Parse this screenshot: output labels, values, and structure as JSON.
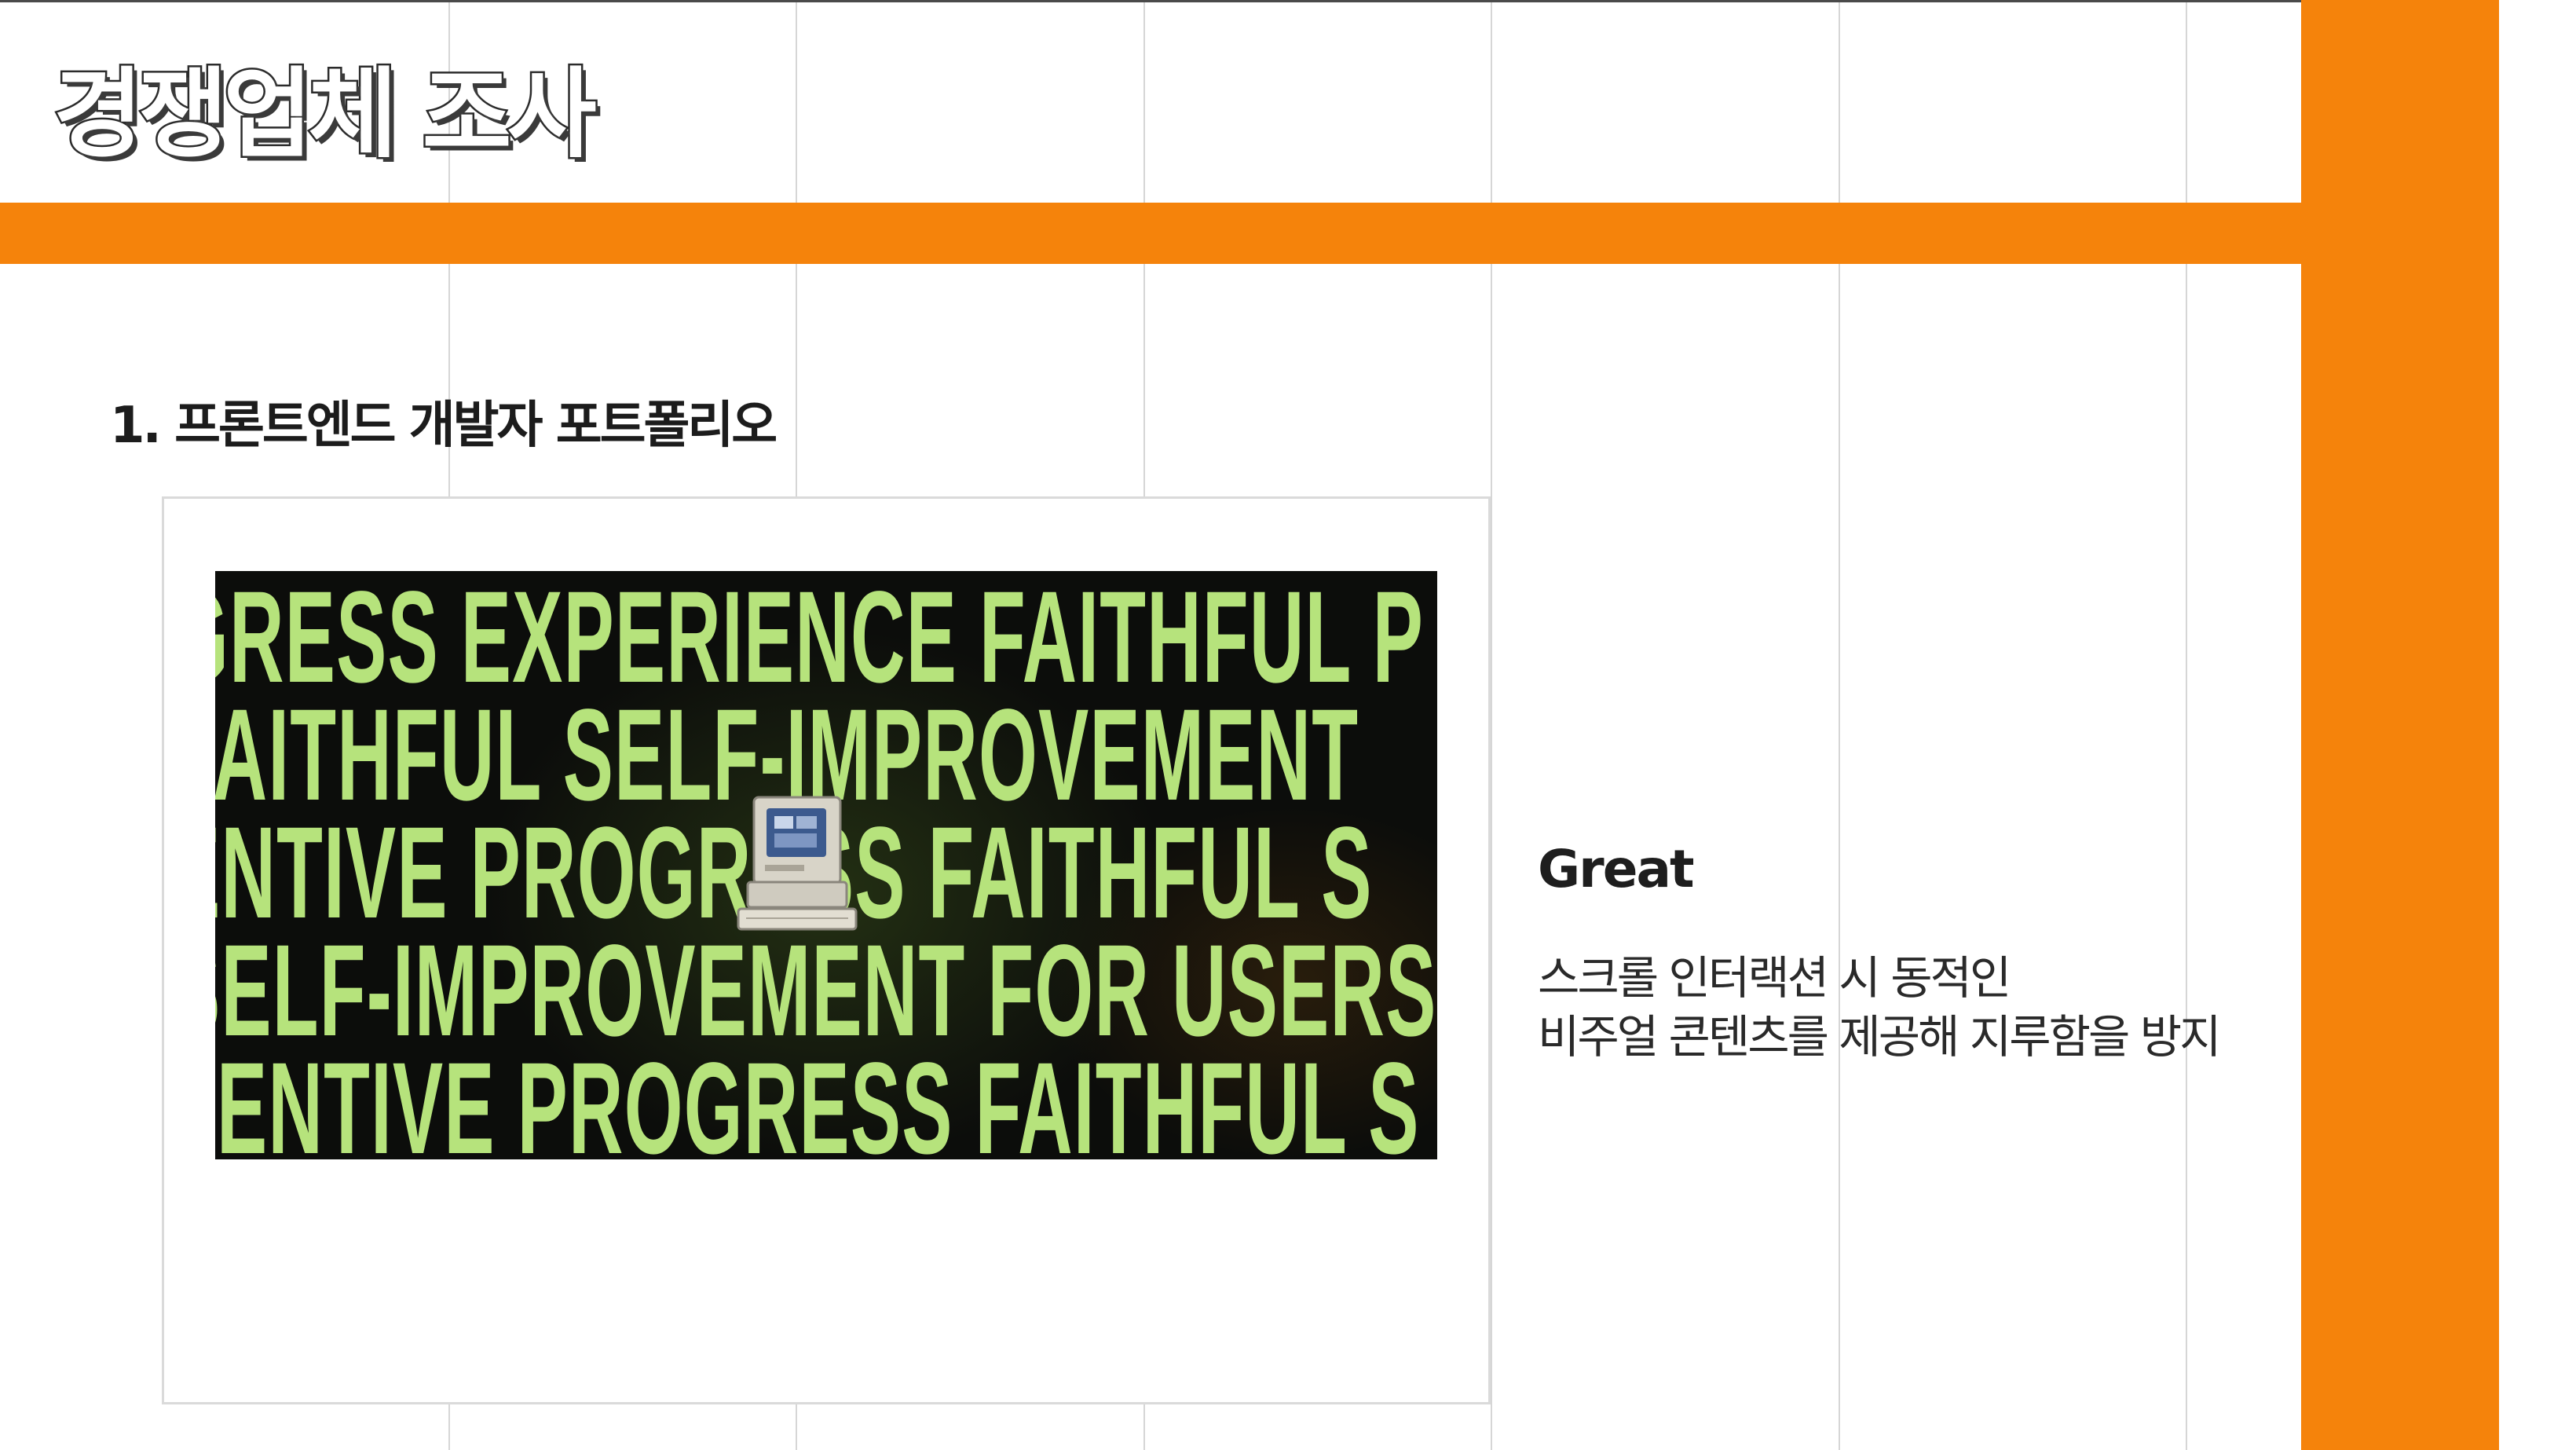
{
  "page": {
    "title": "경쟁업체 조사"
  },
  "colors": {
    "accent": "#f5830b",
    "marquee_text": "#b6e37c",
    "thumbnail_background": "#0c0d0b"
  },
  "section": {
    "heading": "1. 프론트엔드 개발자 포트폴리오"
  },
  "thumbnail": {
    "marquee_lines": [
      "GRESS EXPERIENCE FAITHFUL P",
      "FAITHFUL SELF-IMPROVEMENT",
      "ENTIVE PROGRESS FAITHFUL S",
      "SELF-IMPROVEMENT FOR USERS",
      "TENTIVE PROGRESS FAITHFUL S"
    ],
    "icon": "retro-computer-icon"
  },
  "feature": {
    "title": "Great",
    "description_lines": [
      "스크롤 인터랙션 시 동적인",
      "비주얼 콘텐츠를 제공해 지루함을 방지"
    ]
  }
}
